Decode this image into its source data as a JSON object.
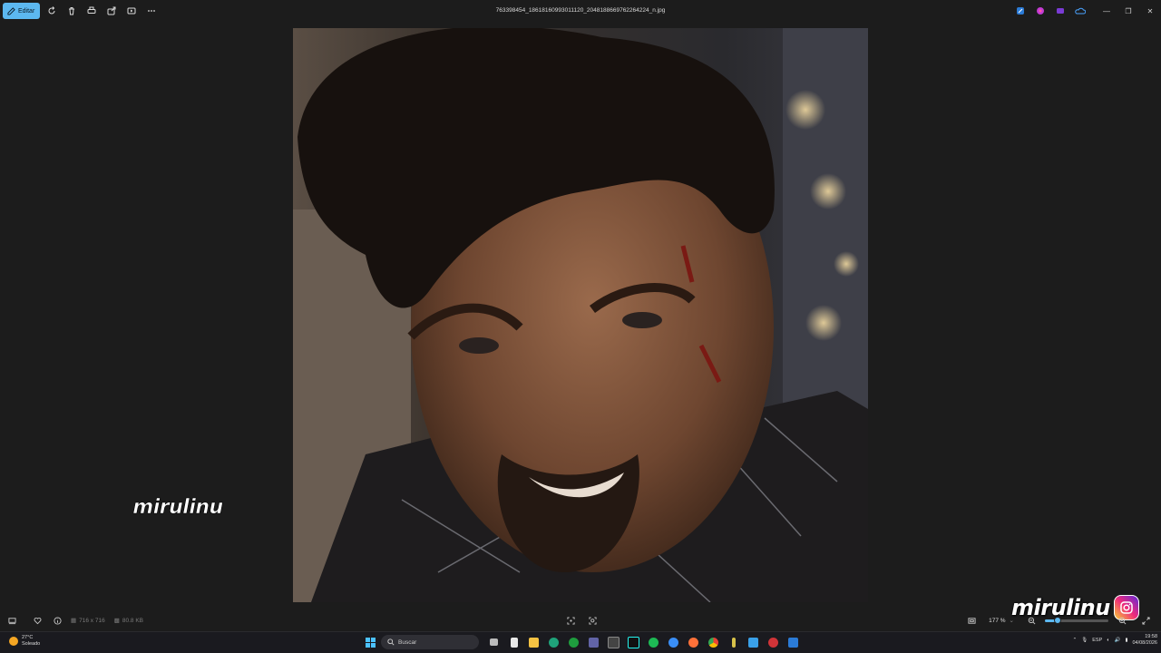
{
  "titlebar": {
    "edit_label": "Editar",
    "file_name": "763398454_18618160993011120_2048188669762264224_n.jpg",
    "window_controls": [
      "minimize",
      "restore",
      "close"
    ]
  },
  "watermarks": {
    "left_logo_text": "mirulinu",
    "bottom_right_text": "mirulinu",
    "bottom_right_icon": "instagram-icon"
  },
  "statusbar": {
    "dimensions": "716 x 716",
    "file_size": "80.8 KB",
    "zoom": "177 %",
    "zoom_fraction": 0.2
  },
  "taskbar": {
    "weather_temp": "27°C",
    "weather_desc": "Soleado",
    "search_placeholder": "Buscar",
    "language": "ESP",
    "time": "19:58",
    "date": "04/08/2026"
  },
  "colors": {
    "accent": "#5cb8f0",
    "background": "#1c1c1c",
    "taskbar": "#1a1a1f"
  }
}
